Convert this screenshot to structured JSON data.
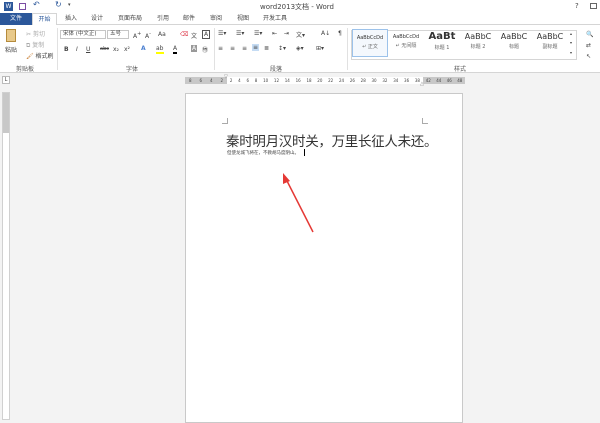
{
  "window": {
    "title": "word2013文档 - Word",
    "help": "?"
  },
  "quick_access": {
    "save": "save-icon",
    "undo": "undo-icon",
    "redo": "redo-icon"
  },
  "tabs": [
    {
      "label": "文件"
    },
    {
      "label": "开始"
    },
    {
      "label": "插入"
    },
    {
      "label": "设计"
    },
    {
      "label": "页面布局"
    },
    {
      "label": "引用"
    },
    {
      "label": "邮件"
    },
    {
      "label": "审阅"
    },
    {
      "label": "视图"
    },
    {
      "label": "开发工具"
    }
  ],
  "clipboard": {
    "paste": "粘贴",
    "cut": "剪切",
    "copy": "复制",
    "format_painter": "格式刷",
    "label": "剪贴板"
  },
  "font": {
    "name": "宋体 (中文正)",
    "size": "五号",
    "case": "Aa",
    "label": "字体",
    "bold": "B",
    "italic": "I",
    "underline": "U",
    "strike": "abc",
    "sub": "x₂",
    "sup": "x²"
  },
  "paragraph": {
    "label": "段落"
  },
  "styles": {
    "label": "样式",
    "items": [
      {
        "preview": "AaBbCcDd",
        "name": "↵ 正文"
      },
      {
        "preview": "AaBbCcDd",
        "name": "↵ 无间隔"
      },
      {
        "preview": "AaBt",
        "name": "标题 1"
      },
      {
        "preview": "AaBbC",
        "name": "标题 2"
      },
      {
        "preview": "AaBbC",
        "name": "标题"
      },
      {
        "preview": "AaBbC",
        "name": "副标题"
      }
    ]
  },
  "ruler": {
    "left_ticks": [
      "8",
      "6",
      "4",
      "2"
    ],
    "ticks": [
      "2",
      "4",
      "6",
      "8",
      "10",
      "12",
      "14",
      "16",
      "18",
      "20",
      "22",
      "24",
      "26",
      "28",
      "30",
      "32",
      "34",
      "36",
      "38"
    ],
    "right_ticks": [
      "42",
      "44",
      "46",
      "48"
    ]
  },
  "document": {
    "line1": "秦时明月汉时关，万里长征人未还。",
    "line2": "但使龙城飞将在，不教胡马度阴山。"
  },
  "annotation": {
    "color": "#e53935"
  },
  "colors": {
    "accent": "#2b579a"
  }
}
